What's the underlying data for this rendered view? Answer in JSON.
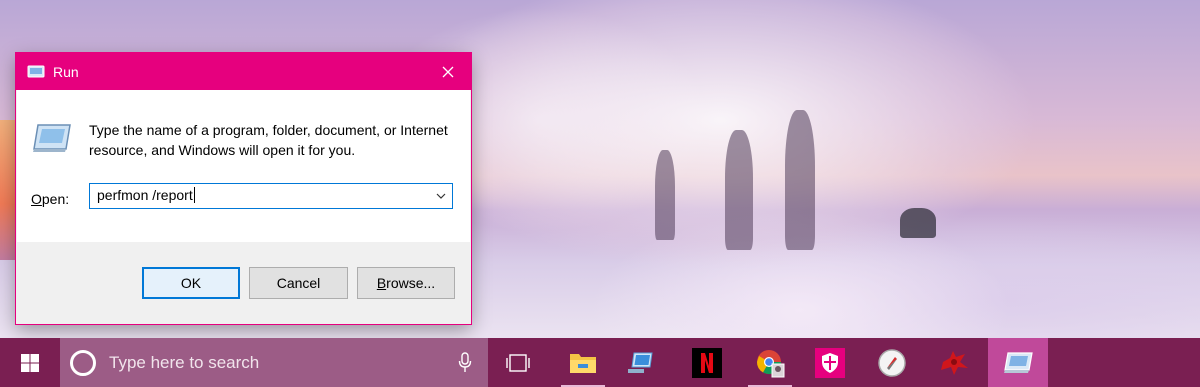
{
  "dialog": {
    "title": "Run",
    "description": "Type the name of a program, folder, document, or Internet resource, and Windows will open it for you.",
    "open_label_prefix": "",
    "open_label_access": "O",
    "open_label_rest": "pen:",
    "input_value": "perfmon /report",
    "buttons": {
      "ok": "OK",
      "cancel": "Cancel",
      "browse_access": "B",
      "browse_rest": "rowse..."
    }
  },
  "taskbar": {
    "search_placeholder": "Type here to search",
    "icons": [
      "windows-start-icon",
      "cortana-icon",
      "microphone-icon",
      "task-view-icon",
      "file-explorer-icon",
      "this-pc-icon",
      "netflix-icon",
      "chrome-icon",
      "security-shield-icon",
      "compass-app-icon",
      "red-bug-icon",
      "run-app-icon"
    ]
  },
  "colors": {
    "accent": "#e6007e",
    "taskbar": "#7a1f52",
    "search_box": "#9c5c86",
    "focus": "#0078d7"
  }
}
